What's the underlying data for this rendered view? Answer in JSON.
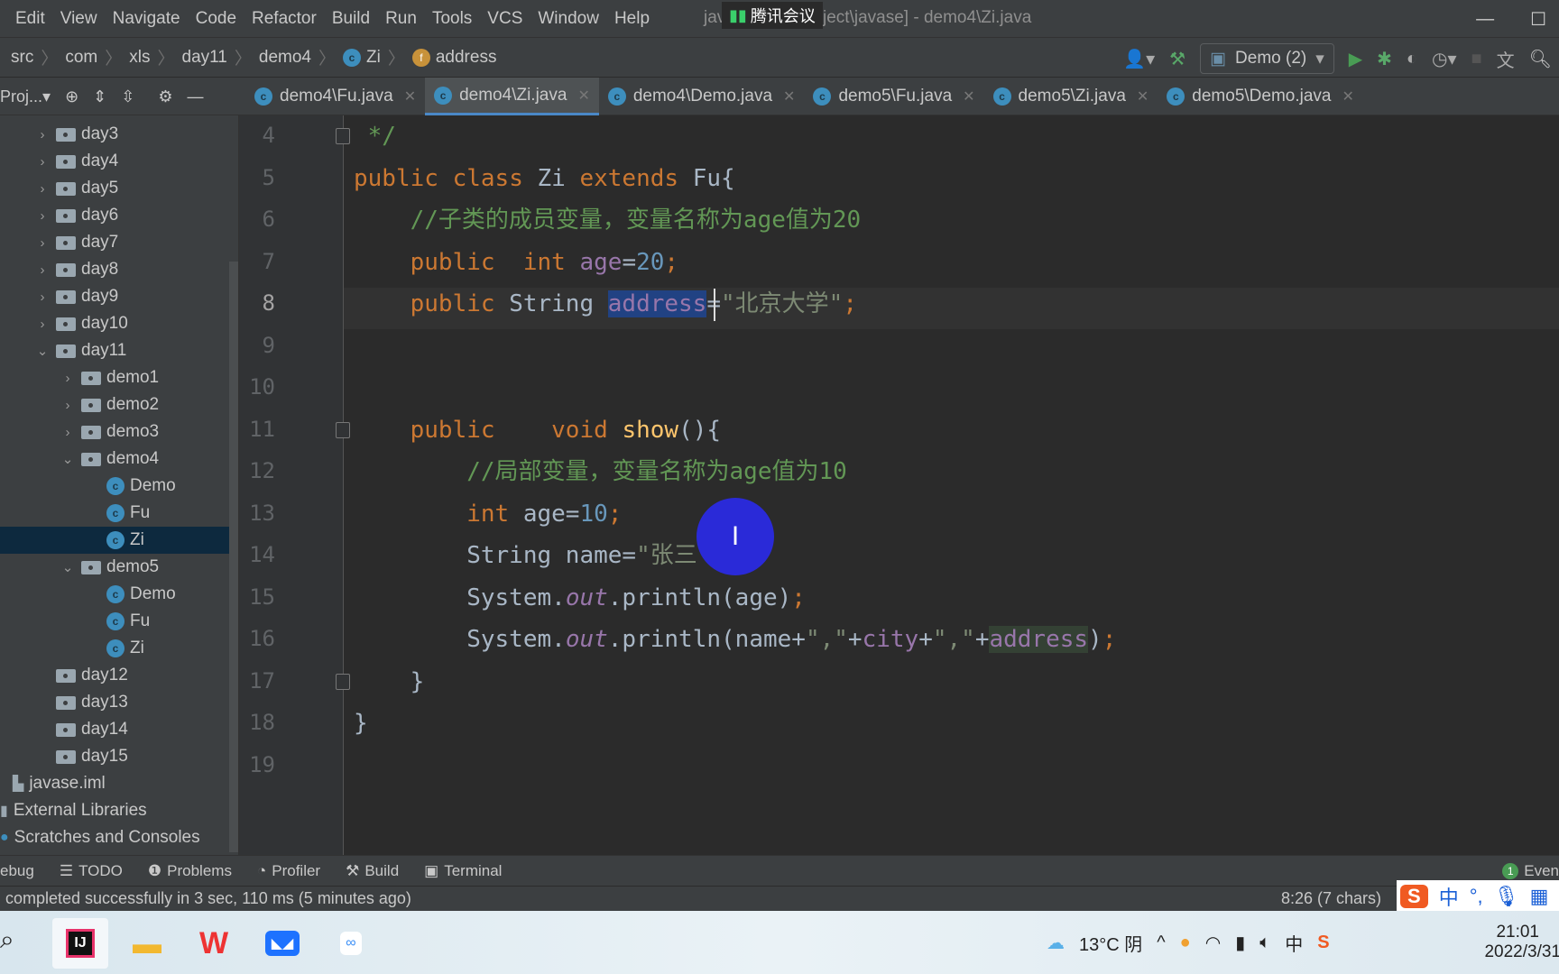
{
  "menu": [
    "Edit",
    "View",
    "Navigate",
    "Code",
    "Refactor",
    "Build",
    "Run",
    "Tools",
    "VCS",
    "Window",
    "Help"
  ],
  "window_title": "javase [E:\\...project\\javase] - demo4\\Zi.java",
  "meeting_overlay": "腾讯会议",
  "breadcrumb": [
    "src",
    "com",
    "xls",
    "day11",
    "demo4",
    "Zi",
    "address"
  ],
  "run_config": "Demo (2)",
  "project_label": "Proj...",
  "tabs": [
    {
      "label": "demo4\\Fu.java",
      "active": false
    },
    {
      "label": "demo4\\Zi.java",
      "active": true
    },
    {
      "label": "demo4\\Demo.java",
      "active": false
    },
    {
      "label": "demo5\\Fu.java",
      "active": false
    },
    {
      "label": "demo5\\Zi.java",
      "active": false
    },
    {
      "label": "demo5\\Demo.java",
      "active": false
    }
  ],
  "tree": [
    {
      "label": "day3",
      "depth": 1,
      "arrow": ">",
      "icon": "folder"
    },
    {
      "label": "day4",
      "depth": 1,
      "arrow": ">",
      "icon": "folder"
    },
    {
      "label": "day5",
      "depth": 1,
      "arrow": ">",
      "icon": "folder"
    },
    {
      "label": "day6",
      "depth": 1,
      "arrow": ">",
      "icon": "folder"
    },
    {
      "label": "day7",
      "depth": 1,
      "arrow": ">",
      "icon": "folder"
    },
    {
      "label": "day8",
      "depth": 1,
      "arrow": ">",
      "icon": "folder"
    },
    {
      "label": "day9",
      "depth": 1,
      "arrow": ">",
      "icon": "folder"
    },
    {
      "label": "day10",
      "depth": 1,
      "arrow": ">",
      "icon": "folder"
    },
    {
      "label": "day11",
      "depth": 1,
      "arrow": "v",
      "icon": "folder"
    },
    {
      "label": "demo1",
      "depth": 2,
      "arrow": ">",
      "icon": "folder"
    },
    {
      "label": "demo2",
      "depth": 2,
      "arrow": ">",
      "icon": "folder"
    },
    {
      "label": "demo3",
      "depth": 2,
      "arrow": ">",
      "icon": "folder"
    },
    {
      "label": "demo4",
      "depth": 2,
      "arrow": "v",
      "icon": "folder"
    },
    {
      "label": "Demo",
      "depth": 3,
      "arrow": "",
      "icon": "class-main"
    },
    {
      "label": "Fu",
      "depth": 3,
      "arrow": "",
      "icon": "class"
    },
    {
      "label": "Zi",
      "depth": 3,
      "arrow": "",
      "icon": "class",
      "selected": true
    },
    {
      "label": "demo5",
      "depth": 2,
      "arrow": "v",
      "icon": "folder"
    },
    {
      "label": "Demo",
      "depth": 3,
      "arrow": "",
      "icon": "class-main"
    },
    {
      "label": "Fu",
      "depth": 3,
      "arrow": "",
      "icon": "class"
    },
    {
      "label": "Zi",
      "depth": 3,
      "arrow": "",
      "icon": "class"
    },
    {
      "label": "day12",
      "depth": 1,
      "arrow": "",
      "icon": "folder"
    },
    {
      "label": "day13",
      "depth": 1,
      "arrow": "",
      "icon": "folder"
    },
    {
      "label": "day14",
      "depth": 1,
      "arrow": "",
      "icon": "folder"
    },
    {
      "label": "day15",
      "depth": 1,
      "arrow": "",
      "icon": "folder"
    },
    {
      "label": "javase.iml",
      "depth": 0,
      "arrow": "",
      "icon": "iml"
    },
    {
      "label": "External Libraries",
      "depth": -1,
      "arrow": "",
      "icon": "lib"
    },
    {
      "label": "Scratches and Consoles",
      "depth": -1,
      "arrow": "",
      "icon": "scratch"
    }
  ],
  "code": [
    {
      "n": "4",
      "tokens": [
        [
          " */",
          "cm"
        ]
      ]
    },
    {
      "n": "5",
      "tokens": [
        [
          "public ",
          "kw"
        ],
        [
          "class ",
          "kw"
        ],
        [
          "Zi ",
          ""
        ],
        [
          "extends ",
          "kw"
        ],
        [
          "Fu{",
          ""
        ]
      ]
    },
    {
      "n": "6",
      "tokens": [
        [
          "    //子类的成员变量，变量名称为age值为20",
          "cm"
        ]
      ]
    },
    {
      "n": "7",
      "tokens": [
        [
          "    public  ",
          "kw"
        ],
        [
          "int ",
          "kw"
        ],
        [
          "age",
          "fd"
        ],
        [
          "=",
          ""
        ],
        [
          "20",
          "nm"
        ],
        [
          ";",
          "kw"
        ]
      ]
    },
    {
      "n": "8",
      "current": true,
      "tokens": [
        [
          "    public ",
          "kw"
        ],
        [
          "String ",
          ""
        ],
        [
          "address",
          "fd sel"
        ],
        [
          "=",
          ""
        ],
        [
          "\"北京大学\"",
          "st"
        ],
        [
          ";",
          "kw"
        ]
      ]
    },
    {
      "n": "9",
      "tokens": []
    },
    {
      "n": "10",
      "tokens": []
    },
    {
      "n": "11",
      "tokens": [
        [
          "    public    ",
          "kw"
        ],
        [
          "void ",
          "kw"
        ],
        [
          "show",
          "mt"
        ],
        [
          "(){",
          ""
        ]
      ]
    },
    {
      "n": "12",
      "tokens": [
        [
          "        //局部变量，变量名称为age值为10",
          "cm"
        ]
      ]
    },
    {
      "n": "13",
      "tokens": [
        [
          "        int ",
          "kw"
        ],
        [
          "age=",
          ""
        ],
        [
          "10",
          "nm"
        ],
        [
          ";",
          "kw"
        ]
      ]
    },
    {
      "n": "14",
      "tokens": [
        [
          "        String name=",
          ""
        ],
        [
          "\"张三\"",
          "st"
        ],
        [
          ";",
          "kw"
        ]
      ]
    },
    {
      "n": "15",
      "tokens": [
        [
          "        System.",
          ""
        ],
        [
          "out",
          "it"
        ],
        [
          ".println(age)",
          ""
        ],
        [
          ";",
          "kw"
        ]
      ]
    },
    {
      "n": "16",
      "tokens": [
        [
          "        System.",
          ""
        ],
        [
          "out",
          "it"
        ],
        [
          ".println(name+",
          ""
        ],
        [
          "\",\"",
          "st"
        ],
        [
          "+",
          ""
        ],
        [
          "city",
          "fd"
        ],
        [
          "+",
          ""
        ],
        [
          "\",\"",
          "st"
        ],
        [
          "+",
          ""
        ],
        [
          "address",
          "fd hl"
        ],
        [
          ")",
          ""
        ],
        [
          ";",
          "kw"
        ]
      ]
    },
    {
      "n": "17",
      "tokens": [
        [
          "    }",
          ""
        ]
      ]
    },
    {
      "n": "18",
      "tokens": [
        [
          "}",
          ""
        ]
      ]
    },
    {
      "n": "19",
      "tokens": []
    }
  ],
  "toolwindows": [
    "ebug",
    "TODO",
    "Problems",
    "Profiler",
    "Build",
    "Terminal"
  ],
  "event_log": {
    "count": "1",
    "label": "Even"
  },
  "status": {
    "message": "completed successfully in 3 sec, 110 ms (5 minutes ago)",
    "position": "8:26 (7 chars)"
  },
  "ime": {
    "lang": "中",
    "punct": "°,"
  },
  "taskbar": {
    "weather": "13°C 阴",
    "time": "21:01",
    "date": "2022/3/31",
    "tray_lang": "中"
  },
  "colors": {
    "keyword": "#cc7832",
    "comment": "#629755",
    "field": "#9876aa",
    "number": "#6897bb",
    "accent": "#4a88c7"
  }
}
